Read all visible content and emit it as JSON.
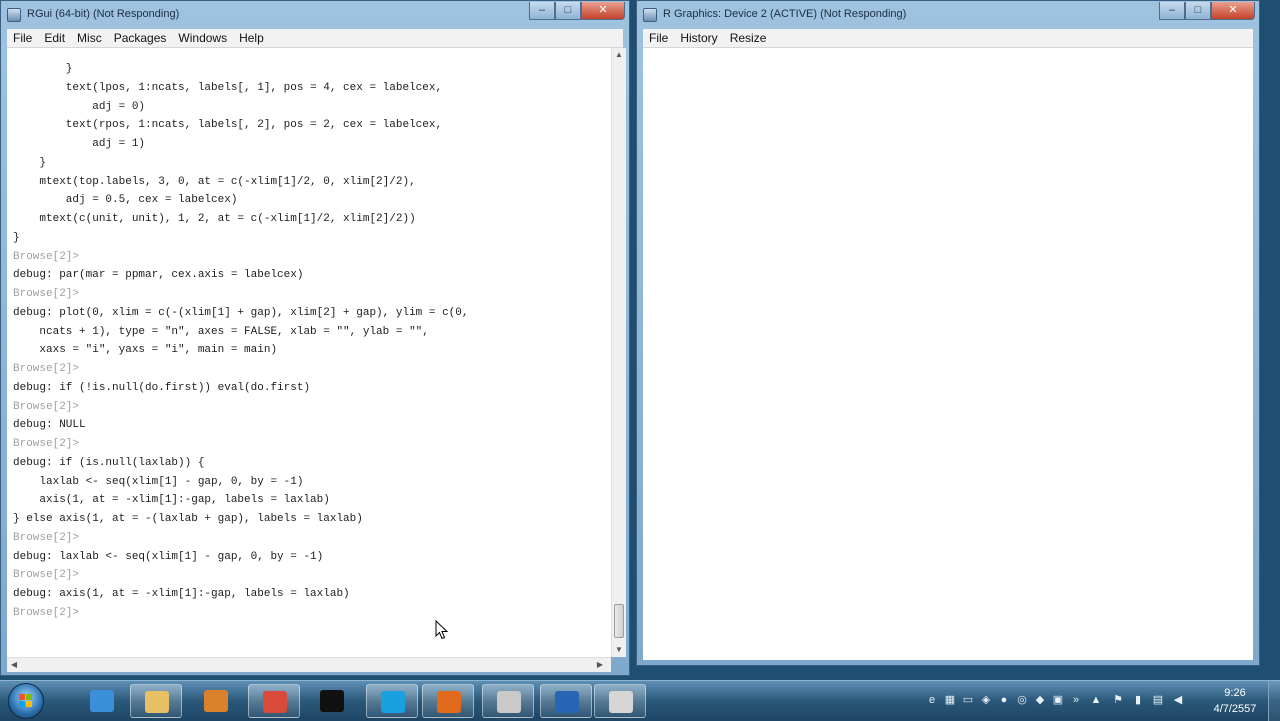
{
  "rgui": {
    "title": "RGui (64-bit) (Not Responding)",
    "menu": [
      "File",
      "Edit",
      "Misc",
      "Packages",
      "Windows",
      "Help"
    ],
    "console_lines": [
      {
        "text": "        }",
        "kind": "code"
      },
      {
        "text": "        text(lpos, 1:ncats, labels[, 1], pos = 4, cex = labelcex,",
        "kind": "code"
      },
      {
        "text": "            adj = 0)",
        "kind": "code"
      },
      {
        "text": "        text(rpos, 1:ncats, labels[, 2], pos = 2, cex = labelcex,",
        "kind": "code"
      },
      {
        "text": "            adj = 1)",
        "kind": "code"
      },
      {
        "text": "    }",
        "kind": "code"
      },
      {
        "text": "    mtext(top.labels, 3, 0, at = c(-xlim[1]/2, 0, xlim[2]/2),",
        "kind": "code"
      },
      {
        "text": "        adj = 0.5, cex = labelcex)",
        "kind": "code"
      },
      {
        "text": "    mtext(c(unit, unit), 1, 2, at = c(-xlim[1]/2, xlim[2]/2))",
        "kind": "code"
      },
      {
        "text": "}",
        "kind": "code"
      },
      {
        "text": "Browse[2]>",
        "kind": "prompt"
      },
      {
        "text": "debug: par(mar = ppmar, cex.axis = labelcex)",
        "kind": "code"
      },
      {
        "text": "Browse[2]>",
        "kind": "prompt"
      },
      {
        "text": "debug: plot(0, xlim = c(-(xlim[1] + gap), xlim[2] + gap), ylim = c(0,",
        "kind": "code"
      },
      {
        "text": "    ncats + 1), type = \"n\", axes = FALSE, xlab = \"\", ylab = \"\",",
        "kind": "code"
      },
      {
        "text": "    xaxs = \"i\", yaxs = \"i\", main = main)",
        "kind": "code"
      },
      {
        "text": "Browse[2]>",
        "kind": "prompt"
      },
      {
        "text": "debug: if (!is.null(do.first)) eval(do.first)",
        "kind": "code"
      },
      {
        "text": "Browse[2]>",
        "kind": "prompt"
      },
      {
        "text": "debug: NULL",
        "kind": "code"
      },
      {
        "text": "Browse[2]>",
        "kind": "prompt"
      },
      {
        "text": "debug: if (is.null(laxlab)) {",
        "kind": "code"
      },
      {
        "text": "    laxlab <- seq(xlim[1] - gap, 0, by = -1)",
        "kind": "code"
      },
      {
        "text": "    axis(1, at = -xlim[1]:-gap, labels = laxlab)",
        "kind": "code"
      },
      {
        "text": "} else axis(1, at = -(laxlab + gap), labels = laxlab)",
        "kind": "code"
      },
      {
        "text": "Browse[2]>",
        "kind": "prompt"
      },
      {
        "text": "debug: laxlab <- seq(xlim[1] - gap, 0, by = -1)",
        "kind": "code"
      },
      {
        "text": "Browse[2]>",
        "kind": "prompt"
      },
      {
        "text": "debug: axis(1, at = -xlim[1]:-gap, labels = laxlab)",
        "kind": "code"
      },
      {
        "text": "Browse[2]>",
        "kind": "prompt"
      }
    ]
  },
  "device": {
    "title": "R Graphics: Device 2 (ACTIVE) (Not Responding)",
    "menu": [
      "File",
      "History",
      "Resize"
    ]
  },
  "window_buttons": {
    "minimize": "–",
    "maximize": "□",
    "close": "✕"
  },
  "taskbar": {
    "items": [
      {
        "name": "ie-icon",
        "color": "#3a8fd8",
        "active": false
      },
      {
        "name": "explorer-icon",
        "color": "#e7c064",
        "active": true
      },
      {
        "name": "media-icon",
        "color": "#d9822b",
        "active": false
      },
      {
        "name": "chrome-icon",
        "color": "#d94a3a",
        "active": true
      },
      {
        "name": "cmd-icon",
        "color": "#111111",
        "active": false
      },
      {
        "name": "skype-icon",
        "color": "#18a0e0",
        "active": true
      },
      {
        "name": "firefox-icon",
        "color": "#e26a1c",
        "active": true
      },
      {
        "name": "pen-icon",
        "color": "#c9c9c9",
        "active": true
      },
      {
        "name": "r-icon",
        "color": "#2766b5",
        "active": true
      },
      {
        "name": "folder-icon",
        "color": "#d6d6d6",
        "active": true
      }
    ],
    "clock_time": "9:26",
    "clock_date": "4/7/2557"
  }
}
